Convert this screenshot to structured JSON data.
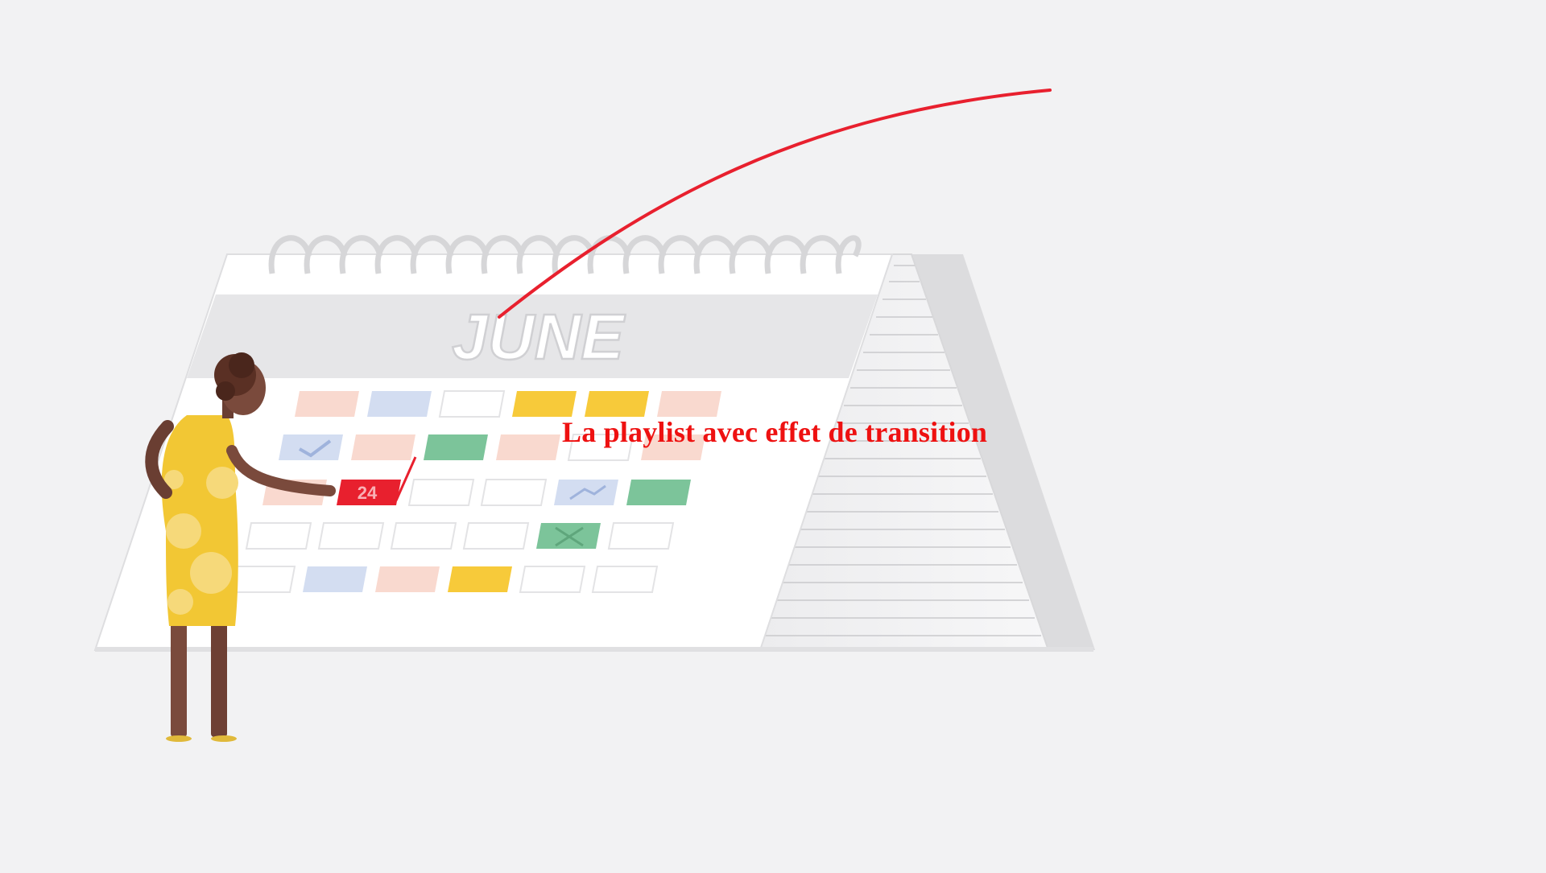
{
  "calendar": {
    "month": "JUNE",
    "highlighted_day": "24"
  },
  "overlay": {
    "caption": "La playlist avec effet de transition"
  },
  "colors": {
    "background": "#f2f2f3",
    "accent_red": "#e8202e",
    "caption_red": "#ee1111",
    "peach": "#f9d9cf",
    "blue": "#d3ddf1",
    "yellow": "#f7ca3a",
    "green": "#7cc49a"
  }
}
